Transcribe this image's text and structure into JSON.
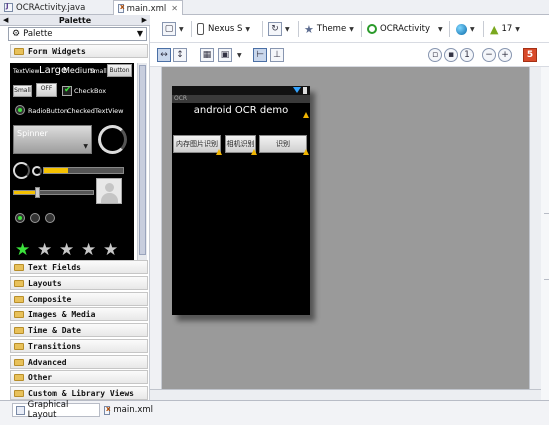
{
  "editor_tabs": [
    {
      "label": "OCRActivity.java",
      "close": ""
    },
    {
      "label": "main.xml",
      "close": "✕"
    }
  ],
  "palette": {
    "title": "Palette",
    "selector_label": "Palette",
    "open_category": "Form Widgets",
    "categories": [
      "Text Fields",
      "Layouts",
      "Composite",
      "Images & Media",
      "Time & Date",
      "Transitions",
      "Advanced",
      "Other",
      "Custom & Library Views"
    ],
    "widgets": {
      "textview": "TextView",
      "large": "Large",
      "medium": "Medium",
      "small": "Small",
      "button": "Button",
      "small_button": "Small",
      "toggle": "OFF",
      "checkbox": "CheckBox",
      "radio": "RadioButton",
      "checked_textview": "CheckedTextView",
      "spinner": "Spinner",
      "rating_filled": 1,
      "rating_total": 5
    }
  },
  "toolbar": {
    "device": "Nexus S",
    "theme": "Theme",
    "activity": "OCRActivity",
    "api_level": "17"
  },
  "device_preview": {
    "titlebar": "OCR",
    "app_title": "android OCR demo",
    "buttons": [
      "内存图片识别",
      "相机识别",
      "识别"
    ]
  },
  "bottom_tabs": [
    "Graphical Layout",
    "main.xml"
  ],
  "colors": {
    "accent_green": "#3ce23c",
    "warning": "#f0b400",
    "canvas_bg": "#9a9a9a"
  }
}
